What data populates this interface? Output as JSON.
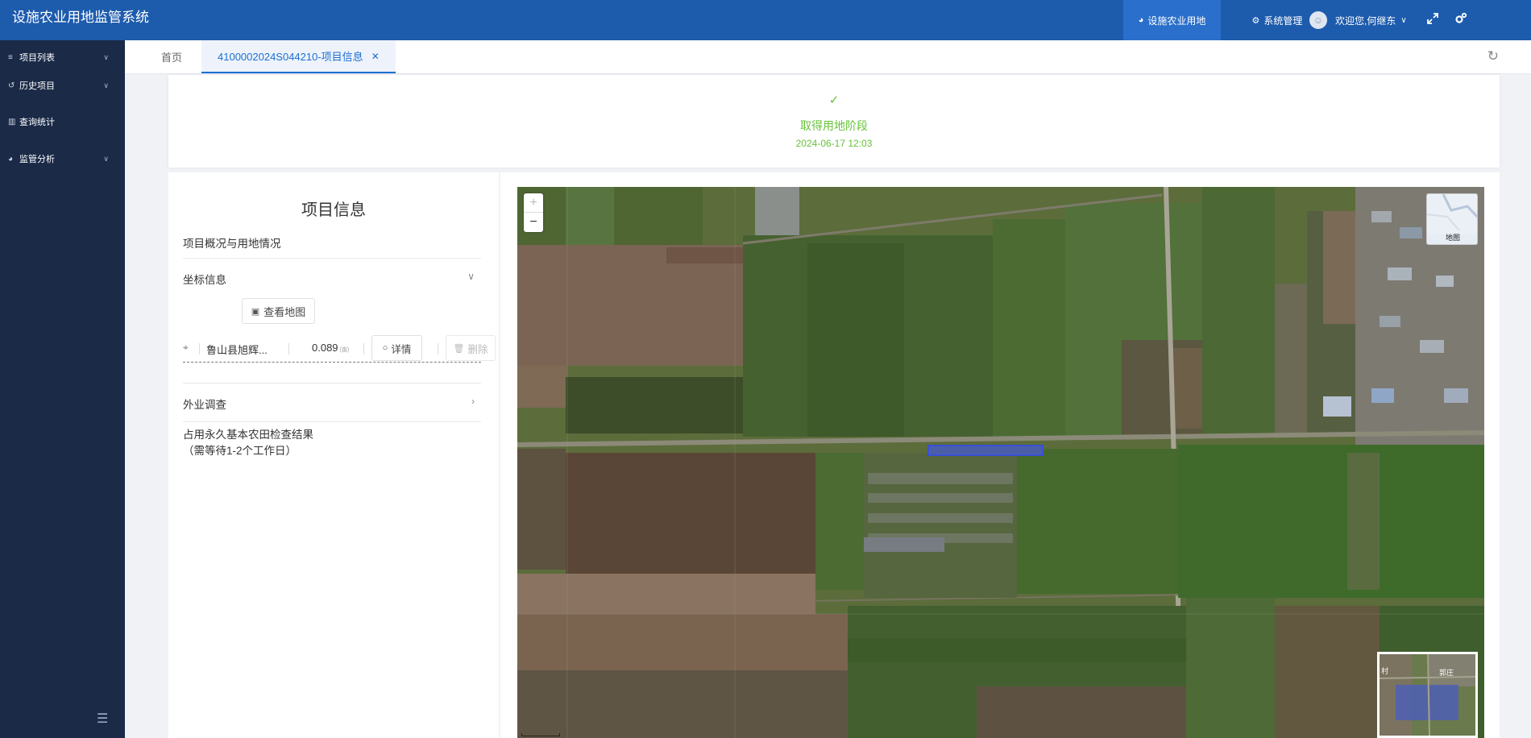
{
  "app": {
    "title": "设施农业用地监管系统"
  },
  "header": {
    "nav": [
      {
        "label": "设施农业用地",
        "icon": "pie-chart-icon",
        "active": true
      },
      {
        "label": "系统管理",
        "icon": "gears-icon",
        "active": false
      }
    ],
    "user": {
      "welcome": "欢迎您,何继东"
    }
  },
  "sidebar": {
    "items": [
      {
        "label": "项目列表",
        "icon": "list-icon",
        "expandable": true
      },
      {
        "label": "历史项目",
        "icon": "history-icon",
        "expandable": true
      },
      {
        "label": "查询统计",
        "icon": "bar-chart-icon",
        "expandable": false
      },
      {
        "label": "监管分析",
        "icon": "pie-chart-icon",
        "expandable": true
      }
    ]
  },
  "tabs": {
    "home": "首页",
    "active": "4100002024S044210-项目信息"
  },
  "stage": {
    "title": "取得用地阶段",
    "time": "2024-06-17 12:03"
  },
  "project": {
    "title": "项目信息",
    "overview": "项目概况与用地情况",
    "coord_section": "坐标信息",
    "view_map": "查看地图",
    "coord": {
      "name": "鲁山县旭辉...",
      "area": "0.089",
      "unit": "(亩)",
      "detail": "详情",
      "delete": "删除"
    },
    "field_survey": "外业调查",
    "farmland_check": "占用永久基本农田检查结果",
    "farmland_wait": "（需等待1-2个工作日）"
  },
  "map": {
    "zoom_in": "+",
    "zoom_out": "−",
    "basemap_label": "地图",
    "overview_labels": [
      "村",
      "郭庄"
    ]
  },
  "colors": {
    "header": "#1d5bad",
    "sidebar": "#1a2a47",
    "success": "#67c23a",
    "primary": "#1d6fd1"
  }
}
